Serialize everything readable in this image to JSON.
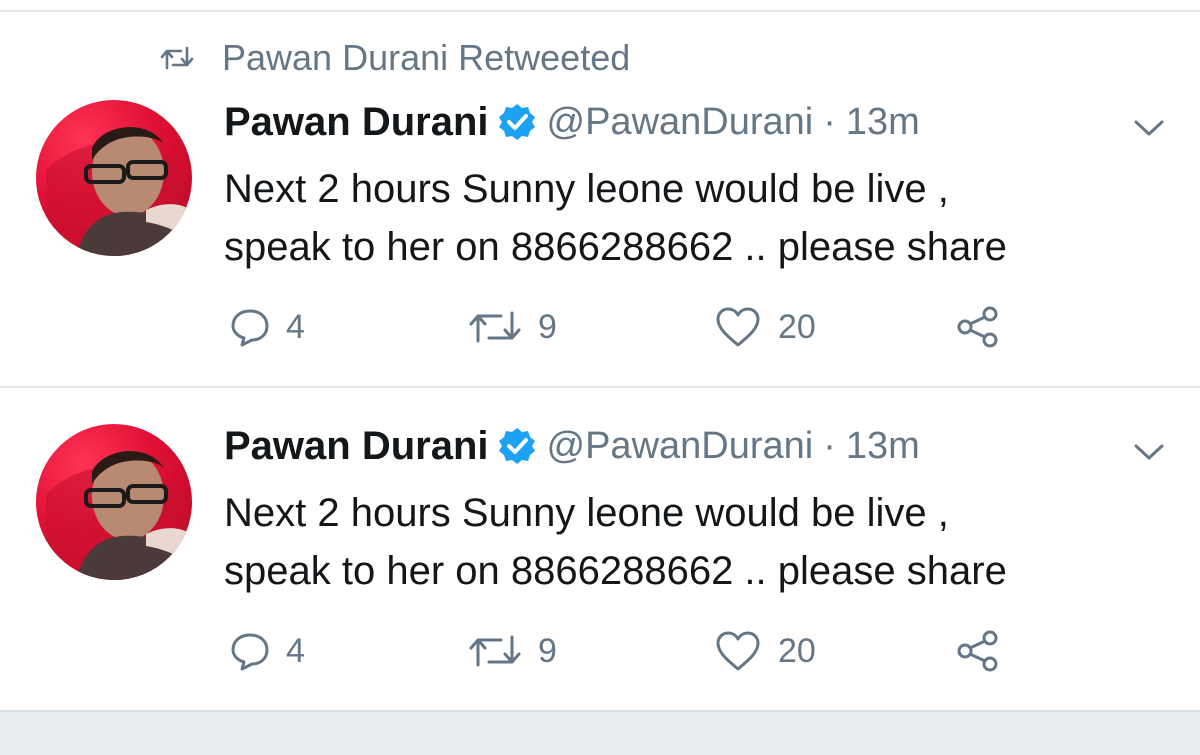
{
  "retweet_context": {
    "text": "Pawan Durani Retweeted",
    "icon": "retweet-icon"
  },
  "tweets": [
    {
      "name": "Pawan Durani",
      "handle": "@PawanDurani",
      "separator": "·",
      "time": "13m",
      "text_line1": "Next 2 hours Sunny leone would be live ,",
      "text_line2": "speak to her on 8866288662 .. please share",
      "replies": "4",
      "retweets": "9",
      "likes": "20"
    },
    {
      "name": "Pawan Durani",
      "handle": "@PawanDurani",
      "separator": "·",
      "time": "13m",
      "text_line1": "Next 2 hours Sunny leone would be live ,",
      "text_line2": "speak to her on 8866288662 .. please share",
      "replies": "4",
      "retweets": "9",
      "likes": "20"
    }
  ],
  "colors": {
    "text": "#14171a",
    "secondary": "#657786",
    "verified": "#1da1f2",
    "divider": "#e1e8ed",
    "avatar_bg": "#e01035"
  }
}
